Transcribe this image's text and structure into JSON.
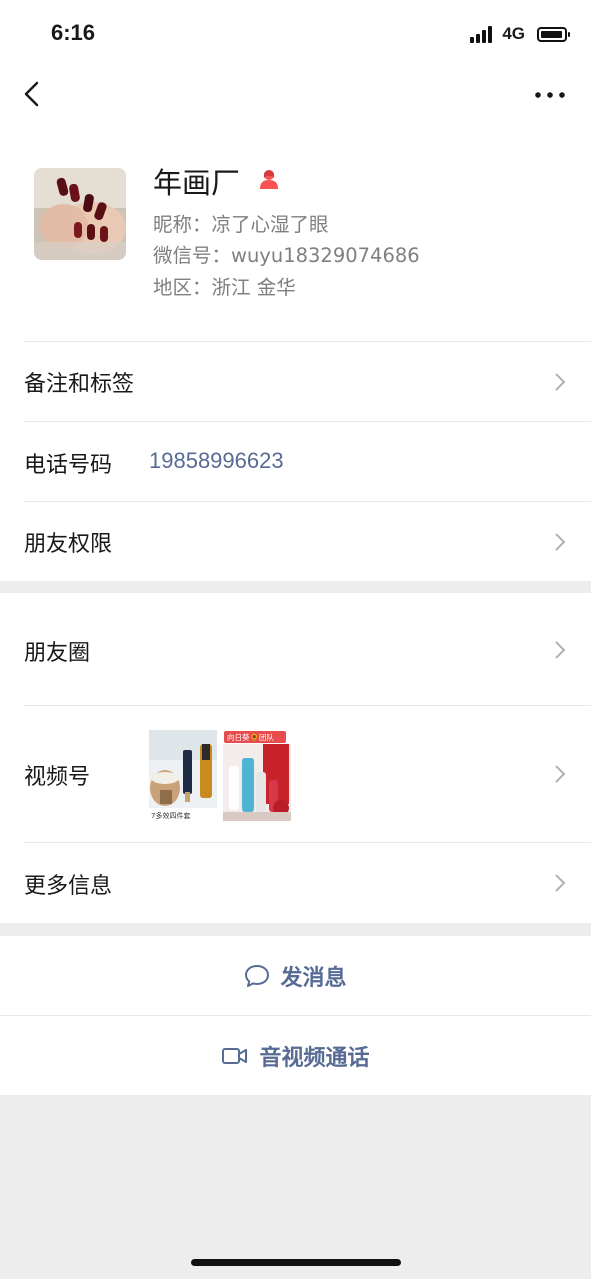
{
  "status_bar": {
    "time": "6:16",
    "network": "4G"
  },
  "nav": {
    "back_icon": "chevron-left-icon",
    "more_icon": "ellipsis-icon"
  },
  "profile": {
    "name": "年画厂",
    "nickname": "昵称：凉了心湿了眼",
    "wechat_id": "微信号：wuyu18329074686",
    "region": "地区：浙江 金华",
    "gender_icon": "female-user-icon",
    "gender_color": "#fa5151"
  },
  "cells": {
    "remark": "备注和标签",
    "phone_label": "电话号码",
    "phone_value": "19858996623",
    "permissions": "朋友权限",
    "moments": "朋友圈",
    "channels": "视频号",
    "more_info": "更多信息"
  },
  "channels_thumbs": {
    "thumb1_caption": "7多效四件套",
    "thumb2_caption": "向日葵🌻团队"
  },
  "actions": {
    "message": "发消息",
    "call": "音视频通话"
  },
  "colors": {
    "link": "#576b95",
    "background": "#ededed",
    "divider": "#e8e8e8"
  }
}
